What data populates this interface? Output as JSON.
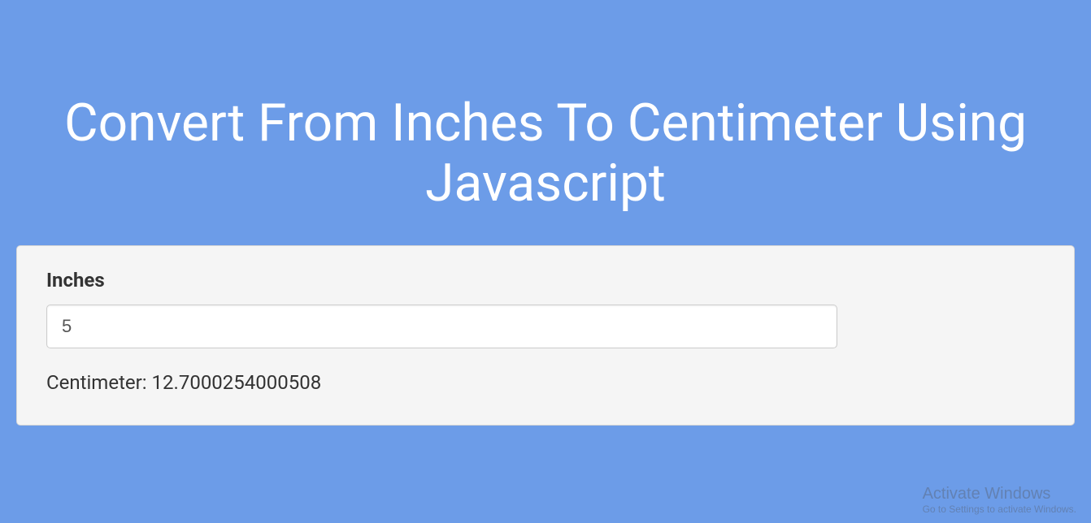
{
  "header": {
    "title": "Convert From Inches To Centimeter Using Javascript"
  },
  "form": {
    "inches_label": "Inches",
    "inches_value": "5",
    "result_text": "Centimeter: 12.7000254000508"
  },
  "watermark": {
    "title": "Activate Windows",
    "subtitle": "Go to Settings to activate Windows."
  }
}
